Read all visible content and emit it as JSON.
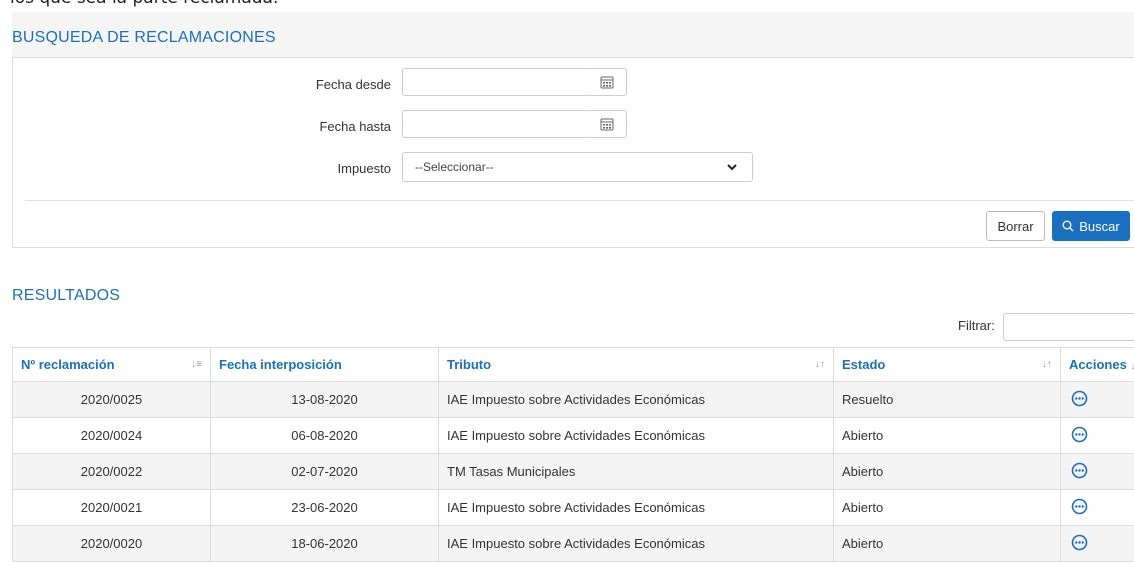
{
  "top_text": "los que sea la parte reclamada.",
  "search": {
    "title": "BUSQUEDA DE RECLAMACIONES",
    "fecha_desde_label": "Fecha desde",
    "fecha_hasta_label": "Fecha hasta",
    "impuesto_label": "Impuesto",
    "fecha_desde_value": "",
    "fecha_hasta_value": "",
    "impuesto_selected": "--Seleccionar--",
    "borrar_label": "Borrar",
    "buscar_label": "Buscar"
  },
  "results": {
    "title": "RESULTADOS",
    "filter_label": "Filtrar:",
    "filter_value": "",
    "columns": [
      "Nº reclamación",
      "Fecha interposición",
      "Tributo",
      "Estado",
      "Acciones"
    ],
    "rows": [
      {
        "numero": "2020/0025",
        "fecha": "13-08-2020",
        "tributo": "IAE Impuesto sobre Actividades Económicas",
        "estado": "Resuelto"
      },
      {
        "numero": "2020/0024",
        "fecha": "06-08-2020",
        "tributo": "IAE Impuesto sobre Actividades Económicas",
        "estado": "Abierto"
      },
      {
        "numero": "2020/0022",
        "fecha": "02-07-2020",
        "tributo": "TM Tasas Municipales",
        "estado": "Abierto"
      },
      {
        "numero": "2020/0021",
        "fecha": "23-06-2020",
        "tributo": "IAE Impuesto sobre Actividades Económicas",
        "estado": "Abierto"
      },
      {
        "numero": "2020/0020",
        "fecha": "18-06-2020",
        "tributo": "IAE Impuesto sobre Actividades Económicas",
        "estado": "Abierto"
      }
    ]
  },
  "icons": {
    "calendar": "calendar-icon",
    "chevron": "chevron-down-icon",
    "search": "search-icon",
    "sort": "sort-icon",
    "actions": "more-options-icon"
  },
  "colors": {
    "accent": "#1a6fc0",
    "row_alt": "#f4f4f4",
    "border": "#dcdcdc"
  }
}
